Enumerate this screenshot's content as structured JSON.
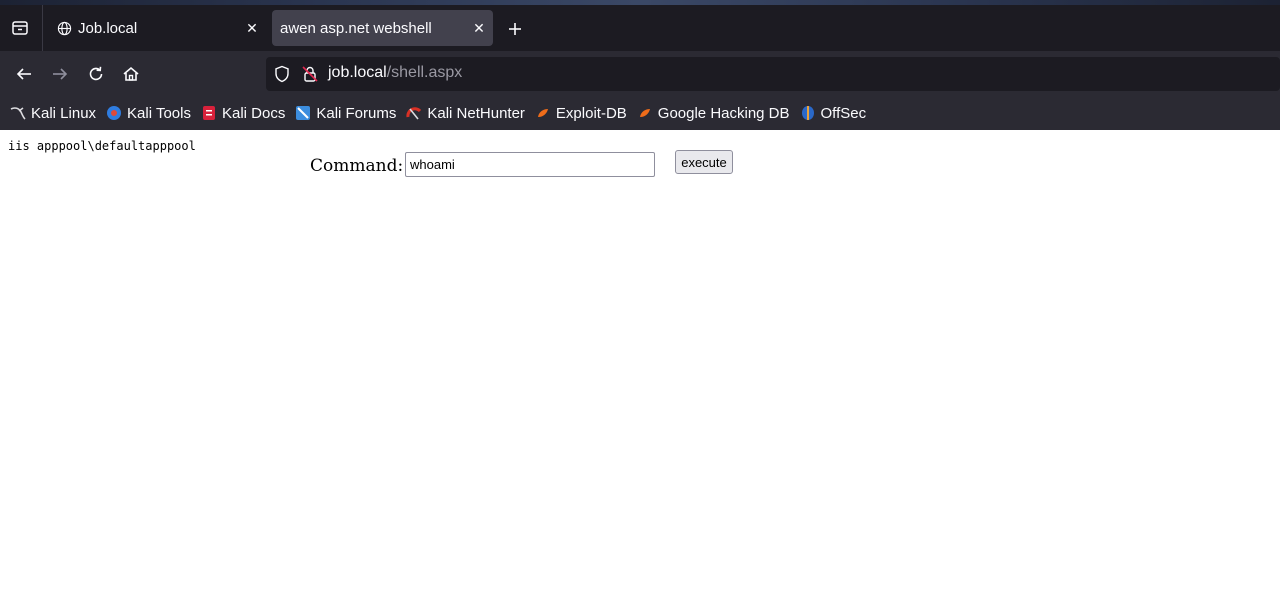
{
  "tabs": [
    {
      "title": "Job.local",
      "favicon": "globe-icon",
      "active": false
    },
    {
      "title": "awen asp.net webshell",
      "favicon": "",
      "active": true
    }
  ],
  "navbar": {
    "url_host": "job.local",
    "url_path": "/shell.aspx"
  },
  "bookmarks": [
    {
      "label": "Kali Linux",
      "icon": "kali-dragon-icon"
    },
    {
      "label": "Kali Tools",
      "icon": "kali-tools-icon"
    },
    {
      "label": "Kali Docs",
      "icon": "kali-docs-icon"
    },
    {
      "label": "Kali Forums",
      "icon": "kali-forums-icon"
    },
    {
      "label": "Kali NetHunter",
      "icon": "kali-nethunter-icon"
    },
    {
      "label": "Exploit-DB",
      "icon": "exploit-db-icon"
    },
    {
      "label": "Google Hacking DB",
      "icon": "ghdb-icon"
    },
    {
      "label": "OffSec",
      "icon": "offsec-icon"
    }
  ],
  "page": {
    "output": "iis apppool\\defaultapppool",
    "command_label": "Command:",
    "command_value": "whoami",
    "execute_label": "execute"
  },
  "colors": {
    "tabbar_bg": "#1c1b22",
    "toolbar_bg": "#2b2a33",
    "active_tab_bg": "#42414d",
    "url_path": "#9a99a3"
  }
}
